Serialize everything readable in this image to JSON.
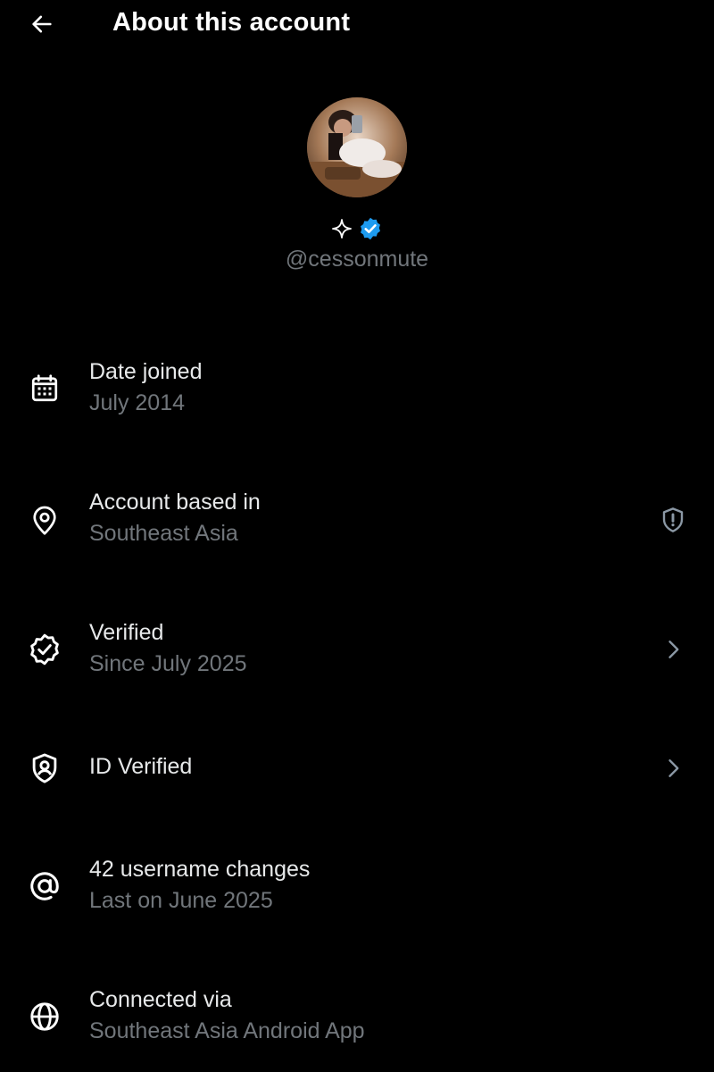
{
  "header": {
    "title": "About this account",
    "back_icon": "arrow-left-icon"
  },
  "profile": {
    "handle": "@cessonmute",
    "avatar": "profile-photo",
    "badges": [
      "sparkle-icon",
      "verified-badge-icon"
    ],
    "verified_color": "#1d9bf0"
  },
  "rows": [
    {
      "icon": "calendar-icon",
      "title": "Date joined",
      "subtitle": "July 2014"
    },
    {
      "icon": "location-pin-icon",
      "title": "Account based in",
      "subtitle": "Southeast Asia",
      "trailing": "shield-alert-icon"
    },
    {
      "icon": "verified-outline-icon",
      "title": "Verified",
      "subtitle": "Since July 2025",
      "trailing": "chevron-right-icon"
    },
    {
      "icon": "id-shield-icon",
      "title": "ID Verified",
      "trailing": "chevron-right-icon"
    },
    {
      "icon": "at-sign-icon",
      "title": "42 username changes",
      "subtitle": "Last on June 2025"
    },
    {
      "icon": "globe-icon",
      "title": "Connected via",
      "subtitle": "Southeast Asia Android App"
    }
  ],
  "colors": {
    "background": "#000000",
    "primary_text": "#e7e9ea",
    "secondary_text": "#71767b",
    "accent": "#1d9bf0"
  }
}
